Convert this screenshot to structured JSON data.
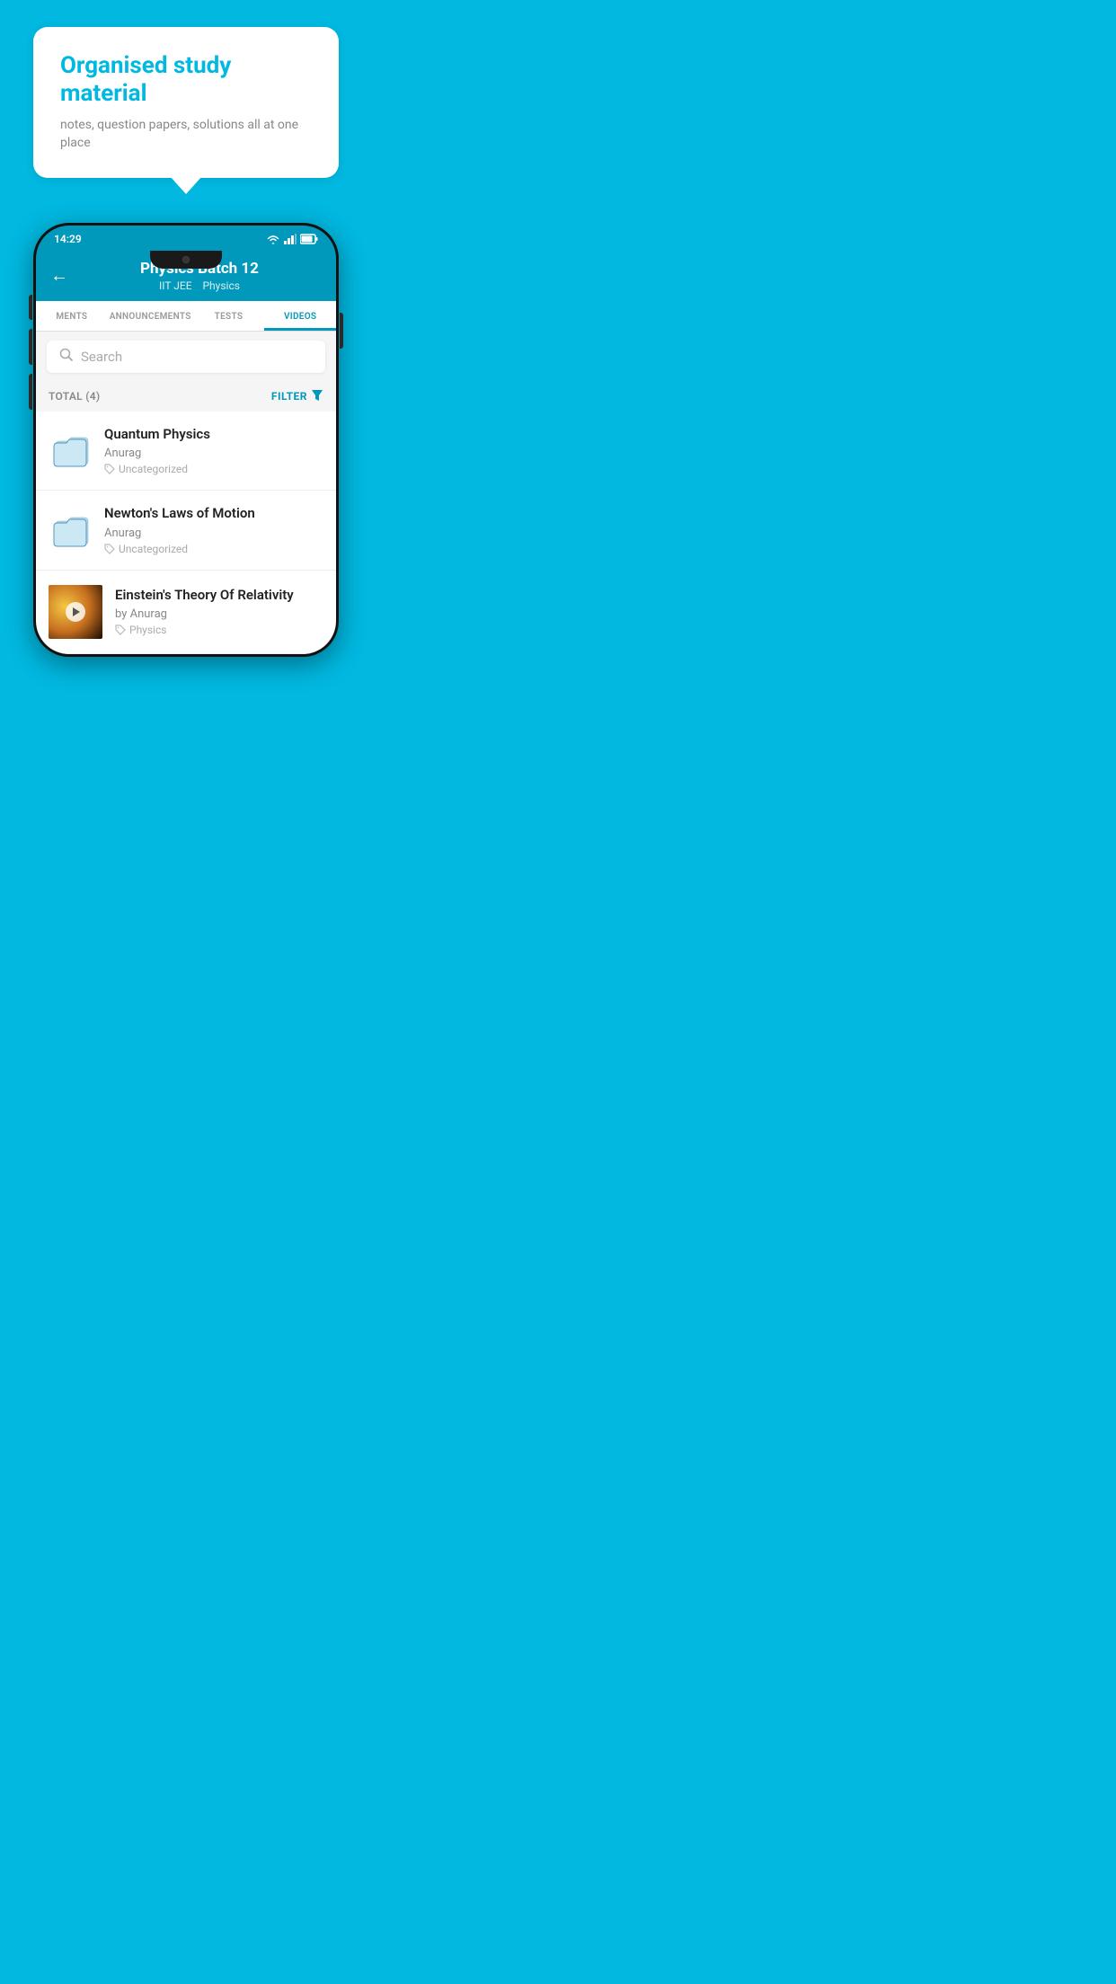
{
  "bubble": {
    "title": "Organised study material",
    "subtitle": "notes, question papers, solutions all at one place"
  },
  "statusBar": {
    "time": "14:29"
  },
  "header": {
    "title": "Physics Batch 12",
    "subtitle_left": "IIT JEE",
    "subtitle_right": "Physics"
  },
  "tabs": [
    {
      "label": "MENTS",
      "active": false
    },
    {
      "label": "ANNOUNCEMENTS",
      "active": false
    },
    {
      "label": "TESTS",
      "active": false
    },
    {
      "label": "VIDEOS",
      "active": true
    }
  ],
  "search": {
    "placeholder": "Search"
  },
  "filterRow": {
    "total": "TOTAL (4)",
    "filterLabel": "FILTER"
  },
  "videos": [
    {
      "title": "Quantum Physics",
      "author": "Anurag",
      "tag": "Uncategorized",
      "hasThumb": false
    },
    {
      "title": "Newton's Laws of Motion",
      "author": "Anurag",
      "tag": "Uncategorized",
      "hasThumb": false
    },
    {
      "title": "Einstein's Theory Of Relativity",
      "author": "by Anurag",
      "tag": "Physics",
      "hasThumb": true
    }
  ]
}
